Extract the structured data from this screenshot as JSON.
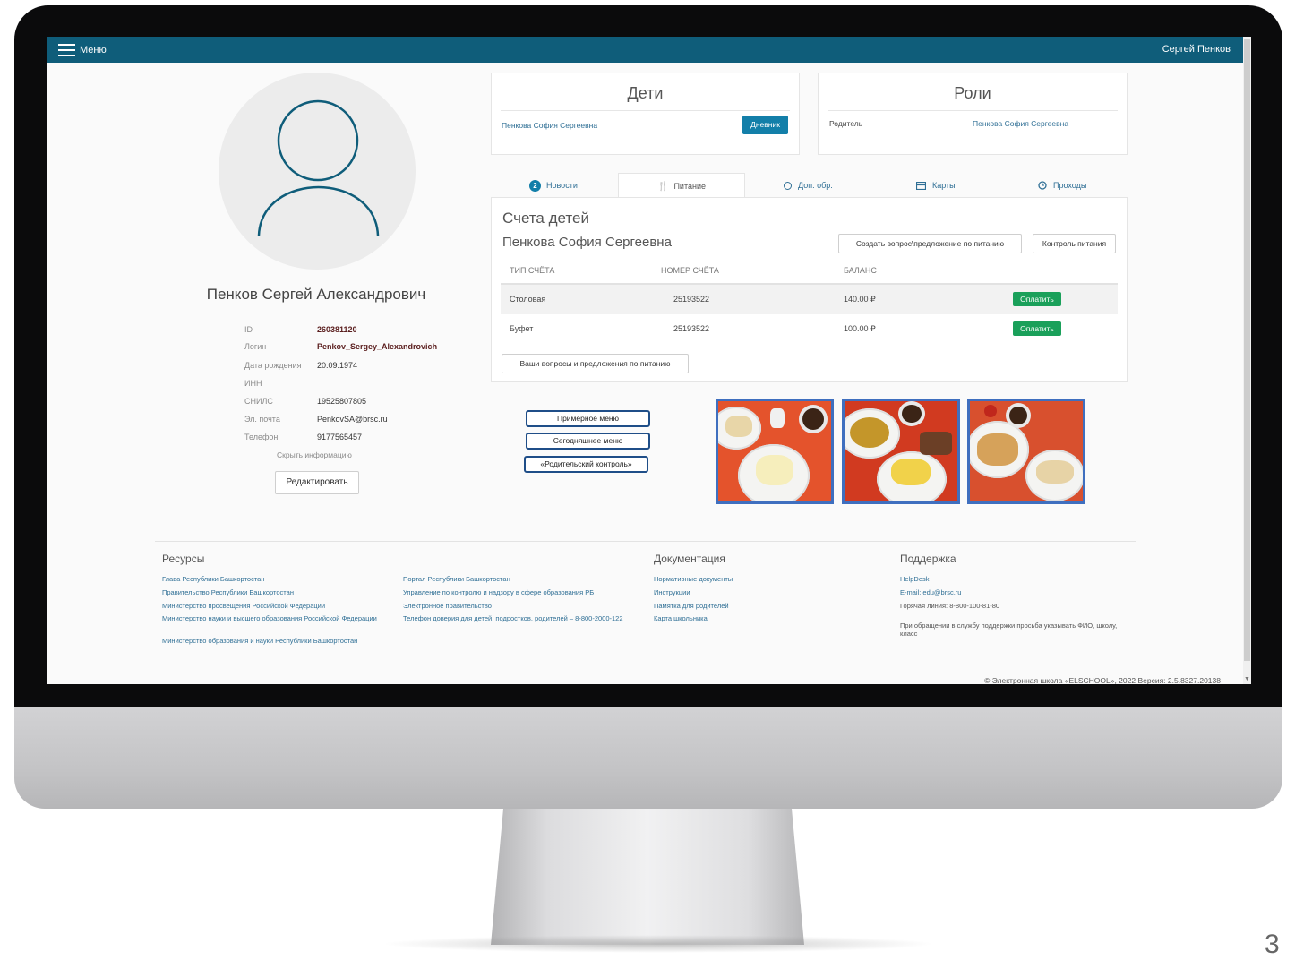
{
  "topbar": {
    "menu_label": "Меню",
    "user_name": "Сергей Пенков"
  },
  "profile": {
    "full_name": "Пенков Сергей Александрович",
    "fields": [
      {
        "label": "ID",
        "value": "260381120"
      },
      {
        "label": "Логин",
        "value": "Penkov_Sergey_Alexandrovich"
      },
      {
        "label": "Дата рождения",
        "value": "20.09.1974"
      },
      {
        "label": "ИНН",
        "value": ""
      },
      {
        "label": "СНИЛС",
        "value": "19525807805"
      },
      {
        "label": "Эл. почта",
        "value": "PenkovSA@brsc.ru"
      },
      {
        "label": "Телефон",
        "value": "9177565457"
      }
    ],
    "hide_info": "Скрыть информацию",
    "edit_label": "Редактировать"
  },
  "children_card": {
    "title": "Дети",
    "child_name": "Пенкова София Сергеевна",
    "diary_label": "Дневник"
  },
  "roles_card": {
    "title": "Роли",
    "role": "Родитель",
    "role_child": "Пенкова София Сергеевна"
  },
  "tabs": [
    {
      "label": "Новости",
      "badge": "2"
    },
    {
      "label": "Питание"
    },
    {
      "label": "Доп. обр."
    },
    {
      "label": "Карты"
    },
    {
      "label": "Проходы"
    }
  ],
  "accounts": {
    "title": "Счета детей",
    "child_name": "Пенкова София Сергеевна",
    "create_question_label": "Создать вопрос\\предложение по питанию",
    "control_label": "Контроль питания",
    "columns": [
      "ТИП СЧЁТА",
      "НОМЕР СЧЁТА",
      "БАЛАНС"
    ],
    "rows": [
      {
        "type": "Столовая",
        "number": "25193522",
        "balance": "140.00 ₽",
        "pay": "Оплатить"
      },
      {
        "type": "Буфет",
        "number": "25193522",
        "balance": "100.00 ₽",
        "pay": "Оплатить"
      }
    ],
    "questions_label": "Ваши вопросы и предложения по питанию"
  },
  "menu_buttons": [
    "Примерное меню",
    "Сегодняшнее меню",
    "«Родительский контроль»"
  ],
  "footer": {
    "resources": {
      "title": "Ресурсы",
      "col1": [
        "Глава Республики Башкортостан",
        "Правительство Республики Башкортостан",
        "Министерство просвещения Российской Федерации",
        "Министерство науки и высшего образования Российской Федерации",
        "Министерство образования и науки Республики Башкортостан"
      ],
      "col2": [
        "Портал Республики Башкортостан",
        "Управление по контролю и надзору в сфере образования РБ",
        "Электронное правительство",
        "Телефон доверия для детей, подростков, родителей – 8-800-2000-122"
      ]
    },
    "docs": {
      "title": "Документация",
      "links": [
        "Нормативные документы",
        "Инструкции",
        "Памятка для родителей",
        "Карта школьника"
      ]
    },
    "support": {
      "title": "Поддержка",
      "helpdesk": "HelpDesk",
      "email": "E-mail: edu@brsc.ru",
      "hotline": "Горячая линия: 8-800-100-81-80",
      "note": "При обращении в службу поддержки просьба указывать ФИО, школу, класс"
    },
    "copyright": "© Электронная школа «ELSCHOOL», 2022 Версия: 2.5.8327.20138"
  },
  "slide_number": "3",
  "colors": {
    "topbar": "#0f5d7a",
    "primary": "#137fa9",
    "pay": "#1aa05a",
    "link": "#2f6f95"
  },
  "icons": [
    "hamburger-icon",
    "user-avatar-icon",
    "fork-knife-icon",
    "circle-icon",
    "card-icon",
    "clock-icon"
  ]
}
